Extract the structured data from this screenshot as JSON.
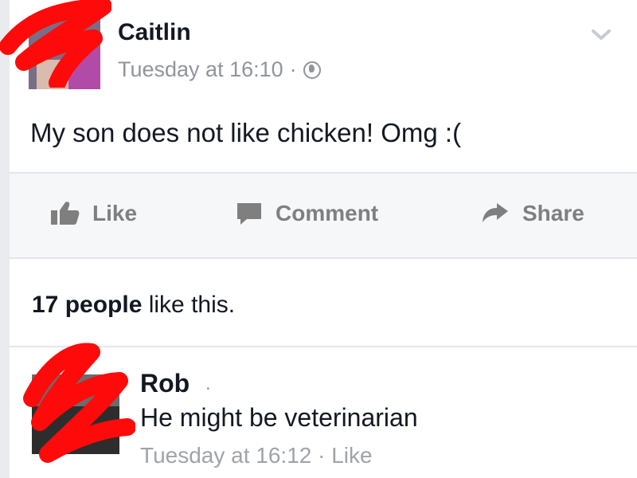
{
  "post": {
    "author": "Caitlin",
    "timestamp": "Tuesday at 16:10",
    "separator": "·",
    "audience_icon": "globe-icon",
    "text": "My son does not like chicken! Omg :("
  },
  "actions": {
    "like": "Like",
    "comment": "Comment",
    "share": "Share"
  },
  "likes_summary": {
    "count": "17 people",
    "suffix": " like this."
  },
  "comment": {
    "author": "Rob",
    "author_suffix": ".",
    "text": "He might be veterinarian",
    "meta": "Tuesday at 16:12 · Like"
  },
  "colors": {
    "redaction": "#ff0a0a",
    "meta_gray": "#90949c",
    "action_gray": "#7f7f7f"
  }
}
